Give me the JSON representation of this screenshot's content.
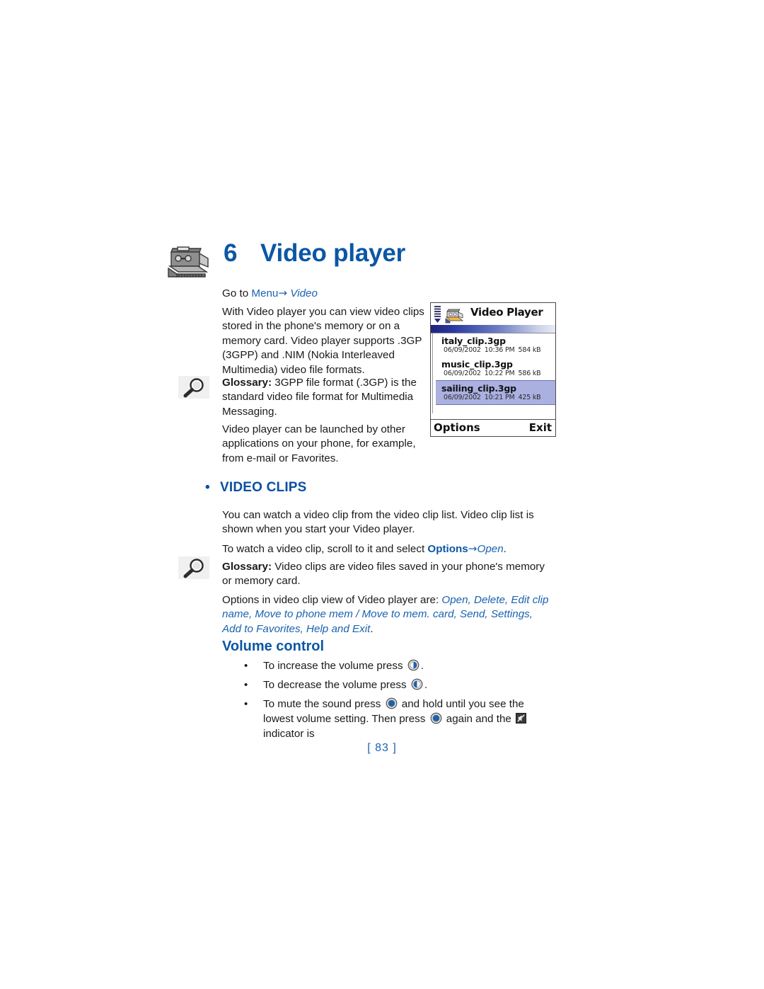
{
  "chapter": {
    "number": "6",
    "title": "Video player",
    "icon": "camcorder-icon"
  },
  "goto_line": {
    "prefix": "Go to ",
    "menu": "Menu",
    "arrow": "→",
    "target": "Video"
  },
  "paragraphs": {
    "intro": "With Video player you can view video clips stored in the phone's memory or on a memory card. Video player supports .3GP (3GPP) and .NIM (Nokia Interleaved Multimedia) video file formats.",
    "glossary1_label": "Glossary:",
    "glossary1_text": " 3GPP file format (.3GP)  is the standard video file format for Multimedia Messaging.",
    "launched": "Video player can be launched by other applications on your phone, for example, from e-mail or Favorites.",
    "watch": "You can watch a video clip from the video clip list. Video clip list is shown when you start your Video player.",
    "scroll_prefix": "To watch a video clip, scroll to it and select ",
    "scroll_options": "Options",
    "scroll_arrow": "→",
    "scroll_open": "Open",
    "scroll_suffix": ".",
    "glossary2_label": "Glossary:",
    "glossary2_text": " Video clips are video files saved in your phone's memory or memory card.",
    "options_prefix": "Options in video clip view of Video player are: ",
    "options_list": "Open, Delete, Edit clip name, Move to phone mem / Move to mem. card, Send, Settings, Add to Favorites, Help and Exit",
    "options_suffix": "."
  },
  "section_heading": {
    "bullet": "•",
    "label": "VIDEO CLIPS"
  },
  "sub_heading": {
    "label": "Volume control"
  },
  "bullets": [
    {
      "dot": "•",
      "text_before": "To increase the volume press ",
      "icon": "volume-up-joystick-icon",
      "text_after": "."
    },
    {
      "dot": "•",
      "text_before": "To decrease the volume press ",
      "icon": "volume-down-joystick-icon",
      "text_after": "."
    },
    {
      "dot": "•",
      "text_before": "To mute the sound press ",
      "icon": "joystick-icon",
      "text_mid": " and hold until you see the lowest volume setting.  Then press ",
      "icon2": "joystick-icon",
      "text_mid2": " again and the ",
      "icon3": "mute-indicator-icon",
      "text_after": " indicator is"
    }
  ],
  "margin_icons": [
    {
      "name": "glossary-magnifier-icon"
    },
    {
      "name": "glossary-magnifier-icon"
    }
  ],
  "page_number": "[ 83 ]",
  "phone_screenshot": {
    "signal_icon": "signal-bars-icon",
    "app_icon": "camcorder-icon",
    "title": "Video Player",
    "clips": [
      {
        "name": "italy_clip.3gp",
        "date": "06/09/2002",
        "time": "10:36 PM",
        "size": "584 kB",
        "selected": false
      },
      {
        "name": "music_clip.3gp",
        "date": "06/09/2002",
        "time": "10:22 PM",
        "size": "586 kB",
        "selected": false
      },
      {
        "name": "sailing_clip.3gp",
        "date": "06/09/2002",
        "time": "10:21 PM",
        "size": "425 kB",
        "selected": true
      }
    ],
    "softkey_left": "Options",
    "softkey_right": "Exit"
  },
  "colors": {
    "heading_blue": "#0b57a4",
    "link_blue": "#1a62b0",
    "section_blue": "#0b4fa4",
    "selection_highlight": "#aab0e0",
    "titlebar_gradient_start": "#20247a",
    "body_text": "#1a1a1a"
  }
}
